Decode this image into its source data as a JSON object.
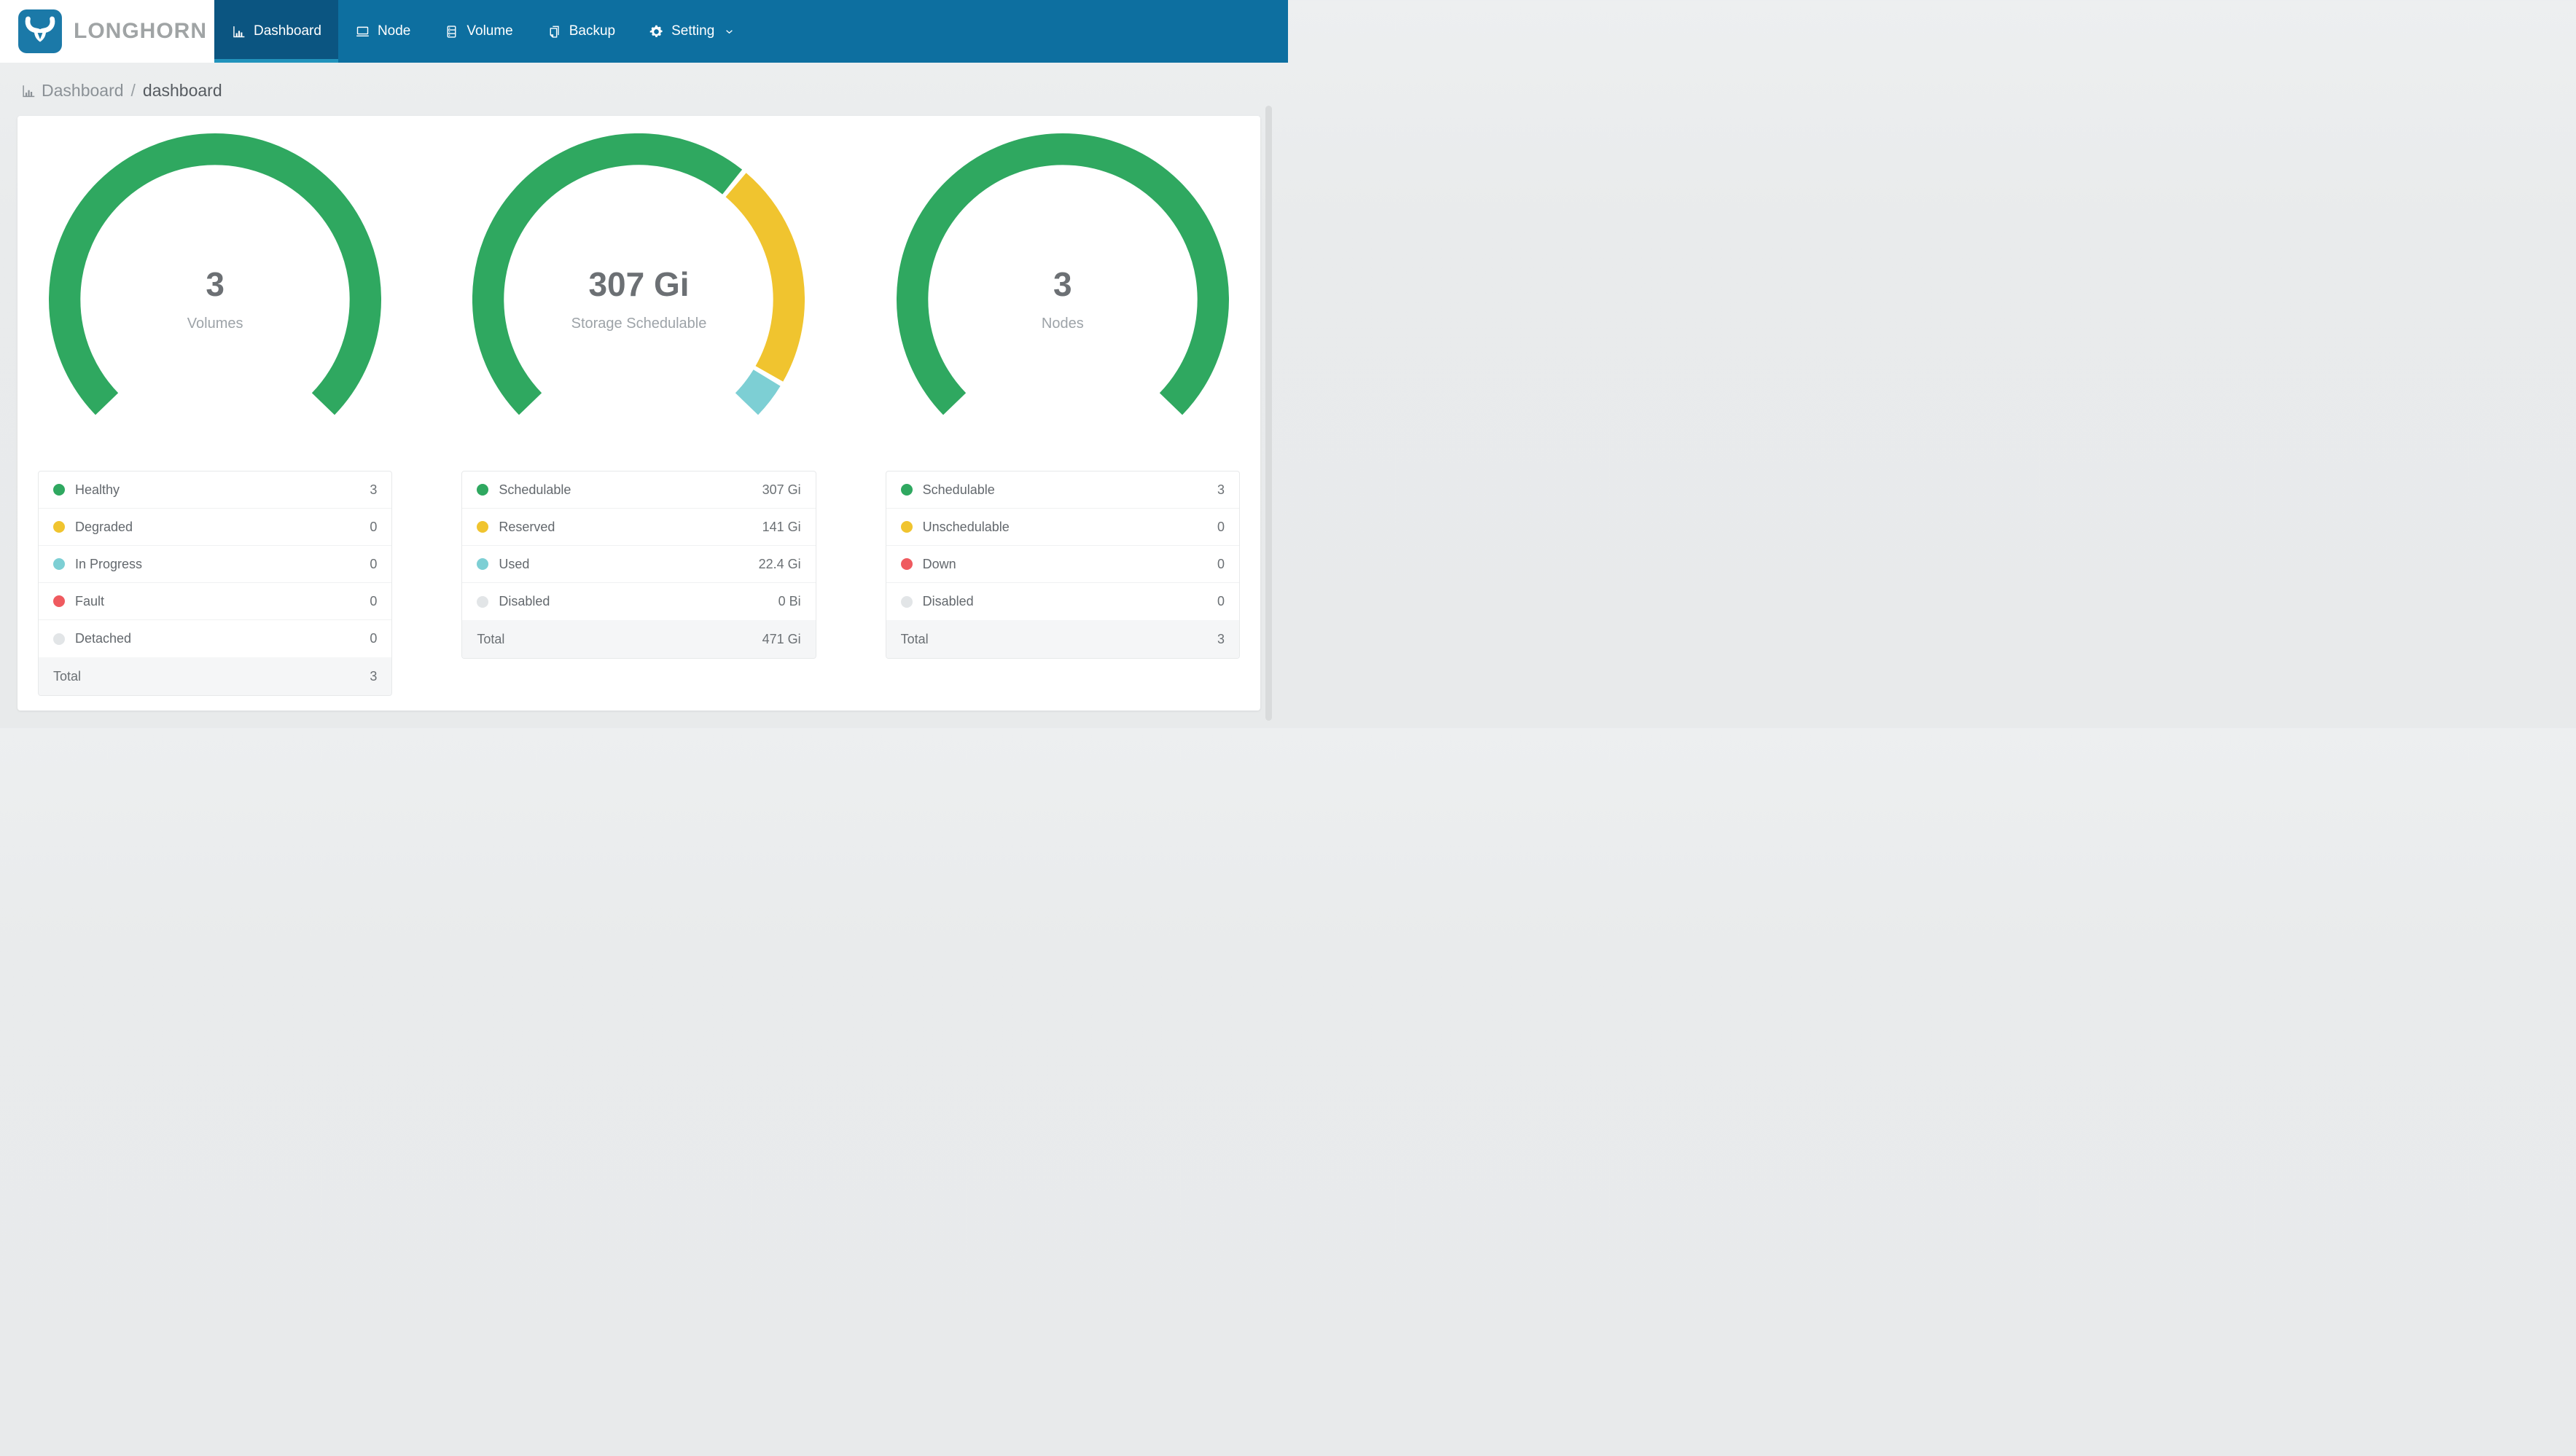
{
  "navbar": {
    "brand": "LONGHORN",
    "items": [
      {
        "label": "Dashboard",
        "icon": "bar-chart-icon",
        "active": true
      },
      {
        "label": "Node",
        "icon": "laptop-icon",
        "active": false
      },
      {
        "label": "Volume",
        "icon": "database-icon",
        "active": false
      },
      {
        "label": "Backup",
        "icon": "copy-icon",
        "active": false
      },
      {
        "label": "Setting",
        "icon": "gear-icon",
        "active": false,
        "has_dropdown": true
      }
    ]
  },
  "breadcrumb": {
    "section": "Dashboard",
    "separator": "/",
    "page": "dashboard"
  },
  "colors": {
    "navbar_bg": "#0D6FA0",
    "navbar_active_bg": "#0B5581",
    "active_tab_strip": "#2193BC",
    "logo_bg": "#1B79A8",
    "brand_text": "#A0A4A5",
    "page_bg": "#E9EBEC",
    "card_bg": "#FFFFFF",
    "healthy_green": "#2FA860",
    "warning_yellow": "#F0C42F",
    "progress_teal": "#7DCFD4",
    "fault_red": "#EF5A5F",
    "disabled_gray": "#E2E5E7",
    "total_row_bg": "#F5F6F7"
  },
  "chart_data": [
    {
      "type": "donut-gauge",
      "title": "Volumes",
      "center_value": "3",
      "center_label": "Volumes",
      "arc": {
        "start_deg": 136,
        "span_deg": 268
      },
      "segments": [
        {
          "label": "Healthy",
          "value": 3,
          "display": "3",
          "color": "#2FA860"
        },
        {
          "label": "Degraded",
          "value": 0,
          "display": "0",
          "color": "#F0C42F"
        },
        {
          "label": "In Progress",
          "value": 0,
          "display": "0",
          "color": "#7DCFD4"
        },
        {
          "label": "Fault",
          "value": 0,
          "display": "0",
          "color": "#EF5A5F"
        },
        {
          "label": "Detached",
          "value": 0,
          "display": "0",
          "color": "#E2E5E7"
        }
      ],
      "total": {
        "label": "Total",
        "display": "3"
      }
    },
    {
      "type": "donut-gauge",
      "title": "Storage Schedulable",
      "center_value": "307 Gi",
      "center_label": "Storage Schedulable",
      "arc": {
        "start_deg": 136,
        "span_deg": 268
      },
      "segments": [
        {
          "label": "Schedulable",
          "value": 307,
          "display": "307 Gi",
          "color": "#2FA860"
        },
        {
          "label": "Reserved",
          "value": 141,
          "display": "141 Gi",
          "color": "#F0C42F"
        },
        {
          "label": "Used",
          "value": 22.4,
          "display": "22.4 Gi",
          "color": "#7DCFD4"
        },
        {
          "label": "Disabled",
          "value": 0,
          "display": "0 Bi",
          "color": "#E2E5E7"
        }
      ],
      "total": {
        "label": "Total",
        "display": "471 Gi"
      }
    },
    {
      "type": "donut-gauge",
      "title": "Nodes",
      "center_value": "3",
      "center_label": "Nodes",
      "arc": {
        "start_deg": 136,
        "span_deg": 268
      },
      "segments": [
        {
          "label": "Schedulable",
          "value": 3,
          "display": "3",
          "color": "#2FA860"
        },
        {
          "label": "Unschedulable",
          "value": 0,
          "display": "0",
          "color": "#F0C42F"
        },
        {
          "label": "Down",
          "value": 0,
          "display": "0",
          "color": "#EF5A5F"
        },
        {
          "label": "Disabled",
          "value": 0,
          "display": "0",
          "color": "#E2E5E7"
        }
      ],
      "total": {
        "label": "Total",
        "display": "3"
      }
    }
  ]
}
